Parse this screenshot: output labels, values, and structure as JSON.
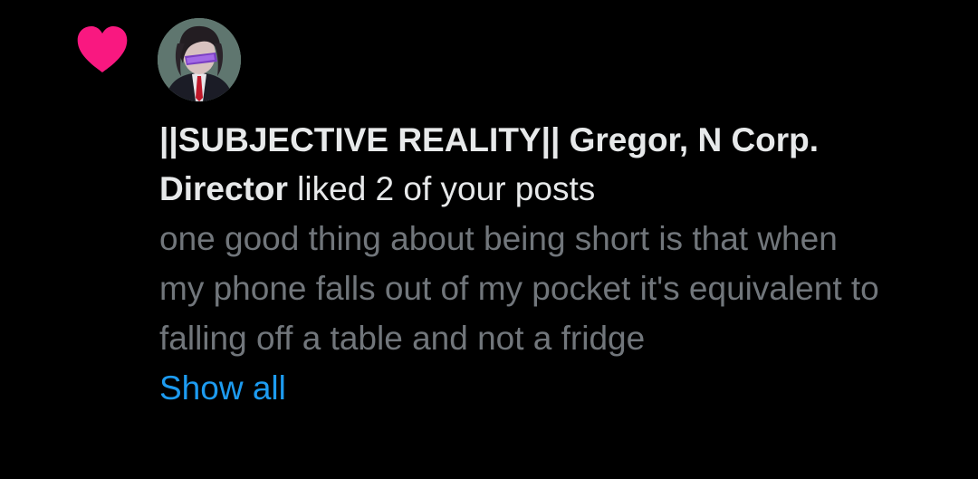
{
  "notification": {
    "type_icon": "heart-icon",
    "icon_color": "#f91880",
    "avatar_icon": "user-avatar",
    "user_name": "||SUBJECTIVE REALITY|| Gregor, N Corp. Director",
    "action_text": " liked 2 of your posts",
    "post_text": "one good thing about being short is that when my phone falls out of my pocket it's equivalent to falling off a table and not a fridge",
    "show_all_label": "Show all",
    "link_color": "#1d9bf0"
  }
}
